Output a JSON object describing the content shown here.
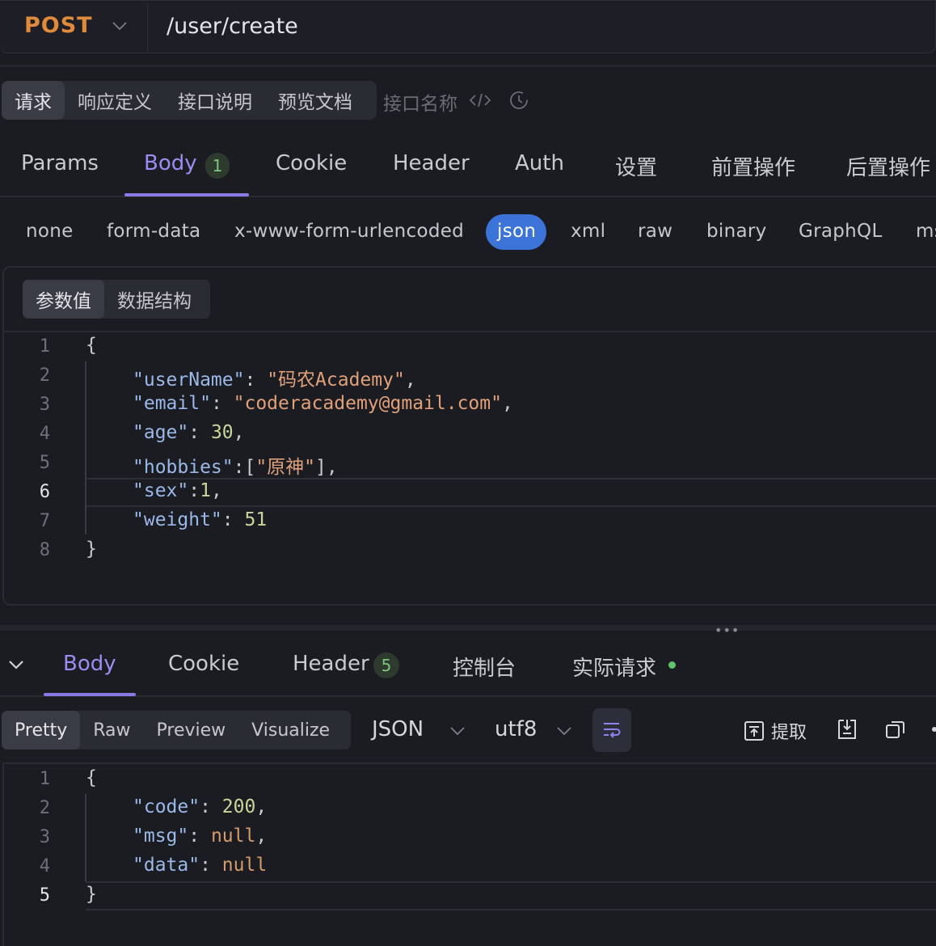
{
  "request": {
    "method": "POST",
    "url": "/user/create"
  },
  "mode_tabs": [
    "请求",
    "响应定义",
    "接口说明",
    "预览文档"
  ],
  "api_name_placeholder": "接口名称",
  "request_tabs": [
    {
      "label": "Params"
    },
    {
      "label": "Body",
      "badge": "1"
    },
    {
      "label": "Cookie"
    },
    {
      "label": "Header"
    },
    {
      "label": "Auth"
    },
    {
      "label": "设置"
    },
    {
      "label": "前置操作"
    },
    {
      "label": "后置操作"
    }
  ],
  "body_types": [
    "none",
    "form-data",
    "x-www-form-urlencoded",
    "json",
    "xml",
    "raw",
    "binary",
    "GraphQL",
    "ms"
  ],
  "body_subtabs": [
    "参数值",
    "数据结构"
  ],
  "request_body": {
    "line_numbers": [
      "1",
      "2",
      "3",
      "4",
      "5",
      "6",
      "7",
      "8"
    ],
    "tokens": {
      "open": "{",
      "close": "}",
      "k_username": "\"userName\"",
      "v_username": "\"码农Academy\"",
      "k_email": "\"email\"",
      "v_email": "\"coderacademy@gmail.com\"",
      "k_age": "\"age\"",
      "v_age": "30",
      "k_hobbies": "\"hobbies\"",
      "v_hobby": "\"原神\"",
      "k_sex": "\"sex\"",
      "v_sex": "1",
      "k_weight": "\"weight\"",
      "v_weight": "51"
    }
  },
  "response_tabs": [
    {
      "label": "Body"
    },
    {
      "label": "Cookie"
    },
    {
      "label": "Header",
      "badge": "5"
    },
    {
      "label": "控制台"
    },
    {
      "label": "实际请求"
    }
  ],
  "view_tabs": [
    "Pretty",
    "Raw",
    "Preview",
    "Visualize"
  ],
  "format": "JSON",
  "encoding": "utf8",
  "extract_label": "提取",
  "response_body": {
    "line_numbers": [
      "1",
      "2",
      "3",
      "4",
      "5"
    ],
    "tokens": {
      "open": "{",
      "close": "}",
      "k_code": "\"code\"",
      "v_code": "200",
      "k_msg": "\"msg\"",
      "v_msg": "null",
      "k_data": "\"data\"",
      "v_data": "null"
    }
  },
  "colors": {
    "method": "#e08a3c",
    "accent": "#8a7ae8",
    "json_pill": "#3b73d8",
    "status_dot": "#5fc46a"
  }
}
